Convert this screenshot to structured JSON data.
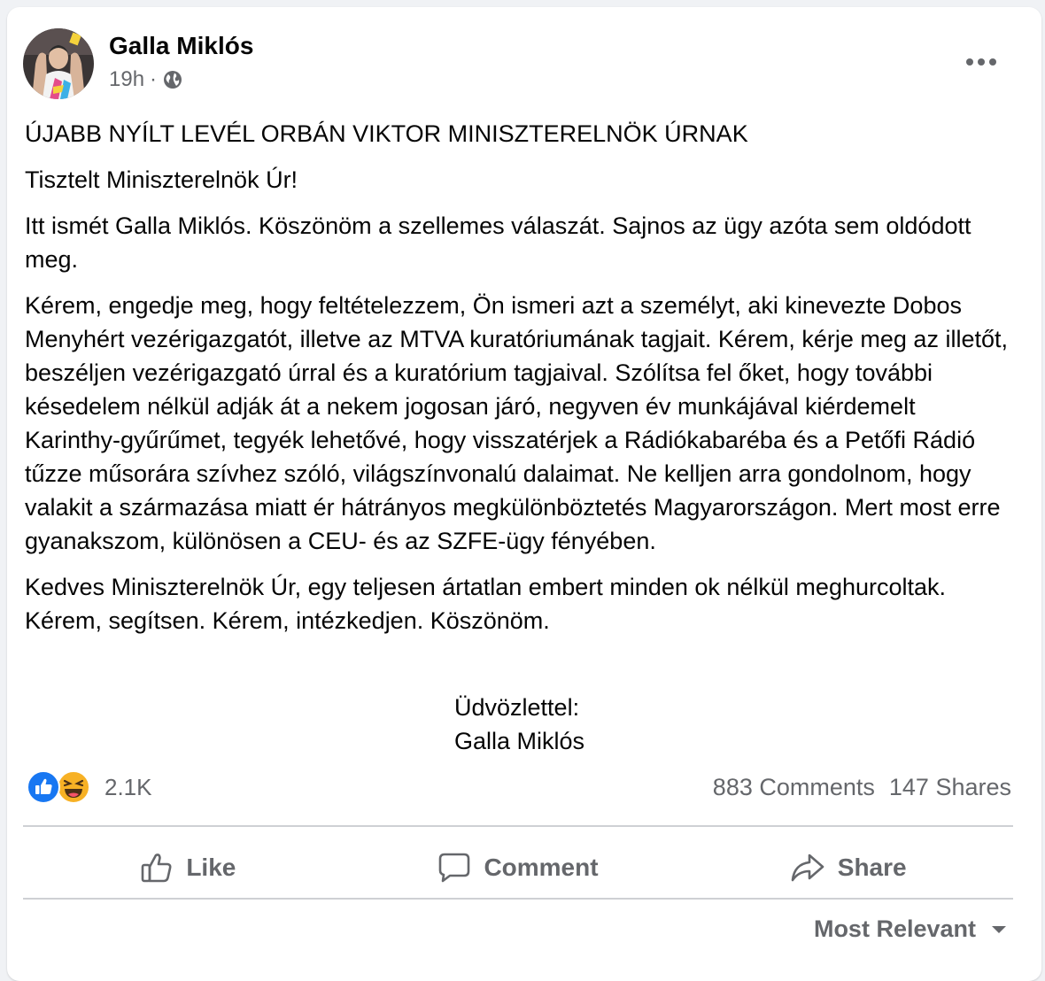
{
  "post": {
    "author": "Galla Miklós",
    "time": "19h",
    "separator": "·",
    "privacy_icon": "globe-icon",
    "more_icon": "more-options-icon",
    "heading": "ÚJABB NYÍLT LEVÉL ORBÁN VIKTOR MINISZTERELNÖK ÚRNAK",
    "greeting": "Tisztelt Miniszterelnök Úr!",
    "paragraphs": [
      "Itt ismét Galla Miklós. Köszönöm a szellemes válaszát. Sajnos az ügy azóta sem oldódott meg.",
      "Kérem, engedje meg, hogy feltételezzem, Ön ismeri azt a személyt, aki kinevezte Dobos Menyhért vezérigazgatót, illetve az MTVA kuratóriumának tagjait. Kérem, kérje meg az illetőt, beszéljen vezérigazgató úrral és a kuratórium tagjaival. Szólítsa fel őket, hogy további késedelem nélkül adják át a nekem jogosan járó, negyven év munkájával kiérdemelt Karinthy-gyűrűmet, tegyék lehetővé, hogy visszatérjek a Rádiókabaréba és a Petőfi Rádió tűzze műsorára szívhez szóló, világszínvonalú dalaimat. Ne kelljen arra gondolnom, hogy valakit a származása miatt ér hátrányos megkülönböztetés Magyarországon. Mert most erre gyanakszom, különösen a CEU- és az SZFE-ügy fényében.",
      "Kedves Miniszterelnök Úr, egy teljesen ártatlan embert minden ok nélkül meghurcoltak. Kérem, segítsen. Kérem, intézkedjen. Köszönöm."
    ],
    "signoff": "Üdvözlettel:",
    "signature": "Galla Miklós"
  },
  "engagement": {
    "reaction_icons": [
      "like-reaction-icon",
      "haha-reaction-icon"
    ],
    "reaction_count": "2.1K",
    "comments": "883 Comments",
    "shares": "147 Shares"
  },
  "actions": {
    "like": "Like",
    "comment": "Comment",
    "share": "Share"
  },
  "comments_sort": {
    "label": "Most Relevant"
  },
  "colors": {
    "like_blue": "#1877f2",
    "haha_yellow": "#f7b125",
    "secondary_text": "#65676b"
  }
}
